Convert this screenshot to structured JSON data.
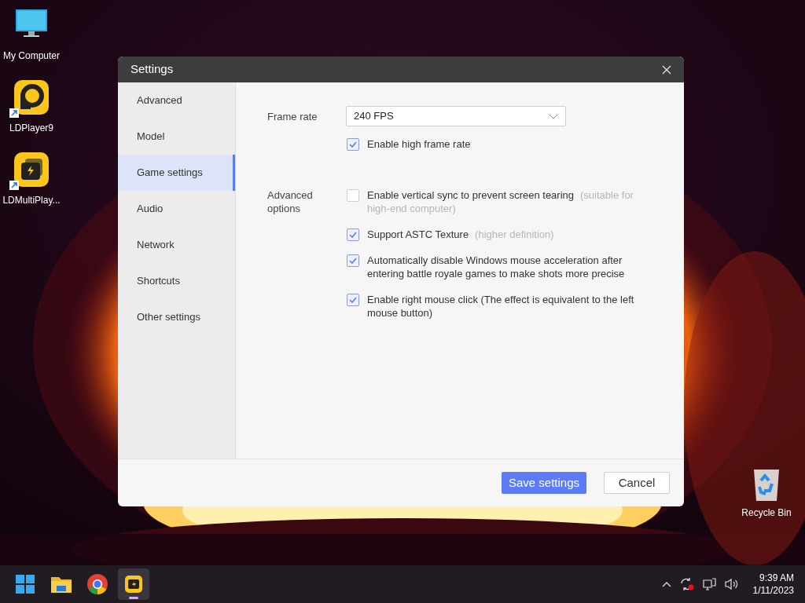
{
  "desktop_icons": [
    {
      "label": "My Computer",
      "kind": "computer",
      "shortcut": false
    },
    {
      "label": "LDPlayer9",
      "kind": "ldplayer",
      "shortcut": true
    },
    {
      "label": "LDMultiPlay...",
      "kind": "multiplayer",
      "shortcut": true
    }
  ],
  "recycle_bin": {
    "label": "Recycle Bin"
  },
  "dialog": {
    "title": "Settings",
    "sidebar": [
      {
        "label": "Advanced",
        "selected": false
      },
      {
        "label": "Model",
        "selected": false
      },
      {
        "label": "Game settings",
        "selected": true
      },
      {
        "label": "Audio",
        "selected": false
      },
      {
        "label": "Network",
        "selected": false
      },
      {
        "label": "Shortcuts",
        "selected": false
      },
      {
        "label": "Other settings",
        "selected": false
      }
    ],
    "frame_rate": {
      "label": "Frame rate",
      "value": "240 FPS"
    },
    "high_frame_rate": {
      "label": "Enable high frame rate",
      "checked": true
    },
    "advanced": {
      "label": "Advanced options",
      "options": [
        {
          "label": "Enable vertical sync to prevent screen tearing",
          "hint": "(suitable for high-end computer)",
          "checked": false
        },
        {
          "label": "Support ASTC Texture",
          "hint": "(higher definition)",
          "checked": true
        },
        {
          "label": "Automatically disable Windows mouse acceleration after entering battle royale games to make shots more precise",
          "checked": true
        },
        {
          "label": "Enable right mouse click (The effect is equivalent to the left mouse button)",
          "checked": true
        }
      ]
    },
    "buttons": [
      {
        "label": "Save settings",
        "kind": "primary"
      },
      {
        "label": "Cancel",
        "kind": "secondary"
      }
    ]
  },
  "taskbar": {
    "apps": [
      {
        "kind": "start",
        "selected": false
      },
      {
        "kind": "folder",
        "selected": false
      },
      {
        "kind": "browser",
        "selected": false
      },
      {
        "kind": "ldplayer",
        "selected": true
      }
    ],
    "clock": {
      "time": "9:39 AM",
      "date": "1/11/2023"
    }
  }
}
